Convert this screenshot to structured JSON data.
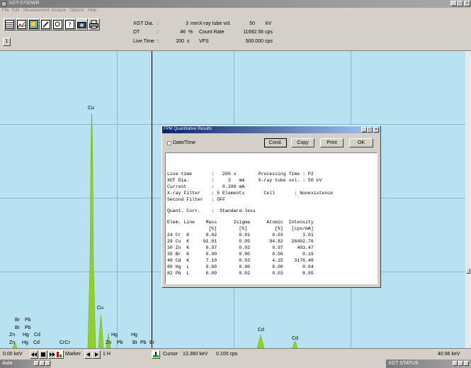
{
  "window": {
    "title": "XGT-5700WR"
  },
  "menu": [
    "File",
    "Edit",
    "Measurement",
    "Analyze",
    "Options",
    "Help"
  ],
  "toolbar": {
    "icons": [
      "spectrum-window-icon",
      "chart-icon",
      "image-icon",
      "edit-icon",
      "print-preview-icon",
      "help-icon",
      "camera-icon",
      "printer-icon"
    ]
  },
  "info": {
    "xgt_label": "XGT Dia.",
    "xgt_value": "3",
    "xgt_unit": "mm",
    "dt_label": "DT",
    "dt_value": "46",
    "dt_unit": "%",
    "live_label": "Live Time",
    "live_value": "200",
    "live_unit": "s",
    "xray_label": "X-ray tube vol.",
    "xray_value": "50",
    "xray_unit": "kV",
    "count_label": "Count Rate",
    "count_value": "11692.56",
    "count_unit": "cps",
    "vfs_label": "VFS",
    "vfs_value": "500.000",
    "vfs_unit": "cps",
    "colon": ":"
  },
  "page_button": "1",
  "spectrum": {
    "peak_labels": {
      "cu_main": "Cu",
      "cu_small": "Cu",
      "br1": "Br",
      "pb1": "Pb",
      "br2": "Br",
      "pb2": "Pb",
      "zn1": "Zn",
      "hg1": "Hg",
      "cd1": "Cd",
      "zn2": "Zn",
      "hg2": "Hg",
      "cd2": "Cd",
      "cr": "CrCr",
      "hg3": "Hg",
      "zn3": "Zn",
      "pb3": "Pb",
      "hg4": "Hg",
      "br3": "Br",
      "pb4": "Pb",
      "br4": "Br",
      "cd3": "Cd",
      "cd4": "Cd"
    }
  },
  "status": {
    "kev_start": "0.00 keV",
    "marker_label": "Marker",
    "marker_value": "1 H",
    "cursor_label": "Cursor",
    "cursor_kev": "13.360 keV",
    "cursor_cps": "0.100 cps",
    "kev_end": "40.96 keV"
  },
  "taskbar": {
    "auto": "Auto",
    "xgt_status": "XGT STATUS"
  },
  "dialog": {
    "title": "FPM Quantitative Results",
    "date_time": "Date/Time",
    "buttons": {
      "cond": "Cond.",
      "copy": "Copy",
      "print": "Print",
      "ok": "OK"
    },
    "report": {
      "l1": "Live time       :   200 s        Processing Time : P2",
      "l2": "XGT Dia.        :     3   mm     X-ray tube vol. : 50 kV",
      "l3": "Current         :   0.280 mA",
      "l4": "X-ray Filter    : 5 Elements       Cell       : Nonexistence",
      "l5": "Second Filter   : OFF",
      "l6": "Quant. Corr.    :  Standard-less",
      "h1": "Elem. Line    Mass      2sigma      Atomic  Intensity",
      "h2": "               [%]        [%]          [%]   [cps/mA]",
      "rows": [
        "24 Cr  K      0.02        0.01        0.03       3.01",
        "29 Cu  K     91.81        0.05       94.82   28402.76",
        "30 Zn  K      0.97        0.02        0.97     403.47",
        "35 Br  K      0.00        0.00        0.00       0.19",
        "48 Cd  K      7.10        0.03        4.15    3176.48",
        "80 Hg  L      0.00        0.00        0.00       0.04",
        "82 Pb  L      0.09        0.02        0.03       8.95"
      ]
    }
  }
}
